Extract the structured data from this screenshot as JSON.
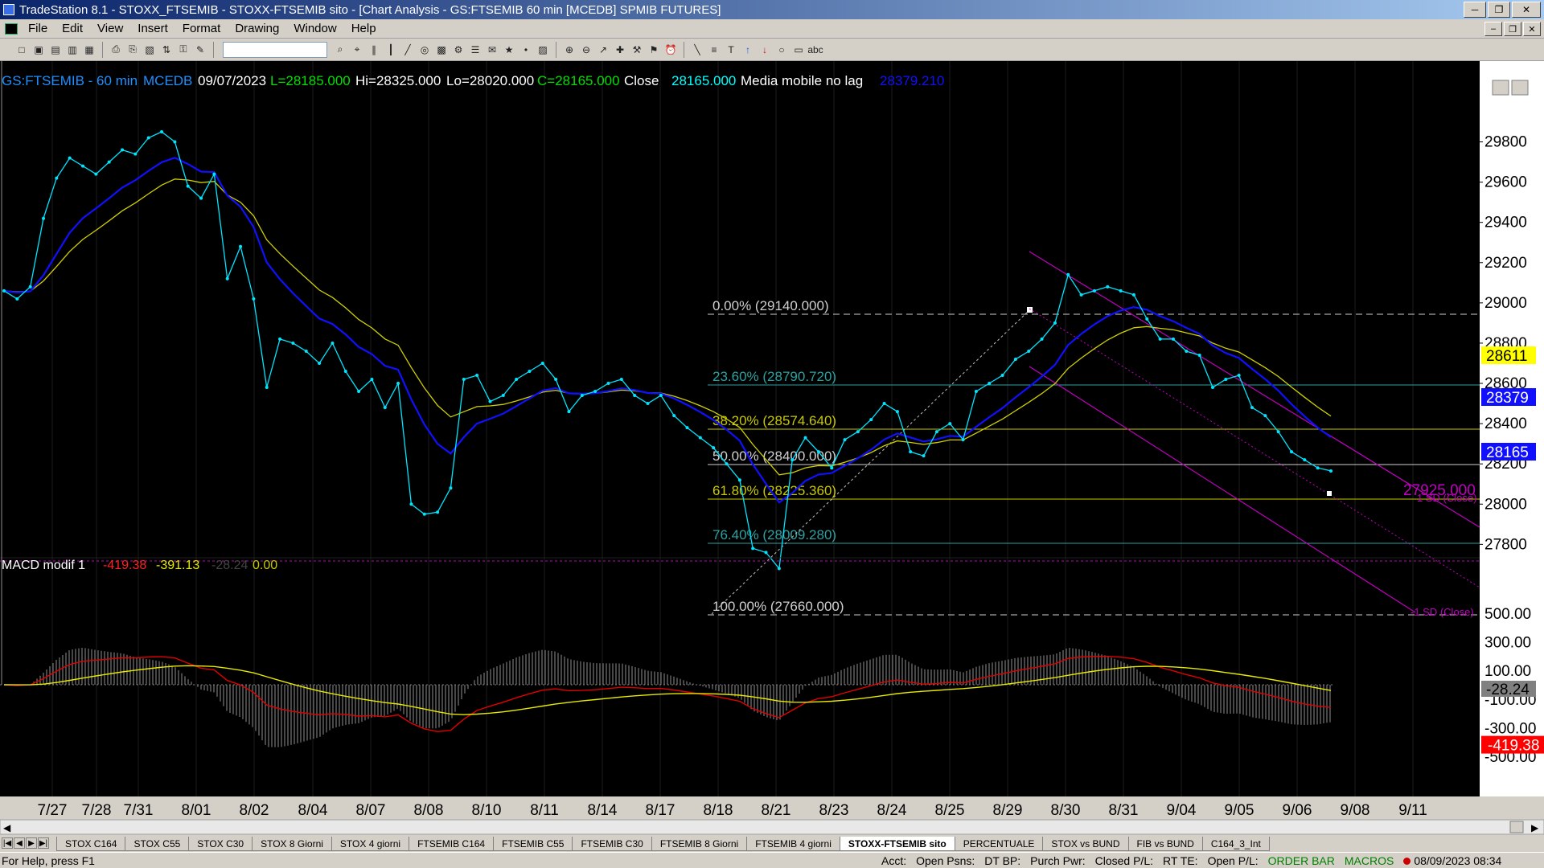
{
  "window": {
    "title": "TradeStation 8.1 - STOXX_FTSEMIB - STOXX-FTSEMIB sito - [Chart Analysis - GS:FTSEMIB  60 min  [MCEDB] SPMIB FUTURES]",
    "minimize": "─",
    "restore": "❐",
    "close": "✕"
  },
  "menu": [
    "File",
    "Edit",
    "View",
    "Insert",
    "Format",
    "Drawing",
    "Window",
    "Help"
  ],
  "toolbar": {
    "symbol_combo": "",
    "icons": [
      "new-icon",
      "open-icon",
      "open-workspace-icon",
      "template-icon",
      "folder-icon",
      "print-icon",
      "print-preview-icon",
      "chart-icon",
      "scroll-icon",
      "lock-icon",
      "format-icon",
      "find-icon",
      "zoom-icon",
      "bars-icon",
      "candles-icon",
      "line-icon",
      "radar-icon",
      "matrix-icon",
      "options-icon",
      "quotes-icon",
      "news-icon",
      "hotlist-icon",
      "tick-icon",
      "data-icon",
      "zoom-in-icon",
      "zoom-out-icon",
      "pointer-icon",
      "crosshair-icon",
      "tools-icon",
      "strategy-icon",
      "alert-icon",
      "trendline-icon",
      "fib-icon",
      "text-icon",
      "up-arrow-icon",
      "down-arrow-icon",
      "circle-icon",
      "rectangle-icon",
      "abc-icon"
    ]
  },
  "chart": {
    "header": {
      "symbol": "GS:FTSEMIB - 60 min",
      "code": "MCEDB",
      "date": "09/07/2023",
      "last": "L=28185.000",
      "high": "Hi=28325.000",
      "low": "Lo=28020.000",
      "close_eq": "C=28165.000",
      "close_label": "Close",
      "close_val": "28165.000",
      "ma_label": "Media mobile no lag",
      "ma_val": "28379.210"
    },
    "macd_header": {
      "name": "MACD modif 1",
      "v1": "-419.38",
      "v2": "-391.13",
      "v3": "-28.24",
      "v4": "0.00"
    },
    "price_axis": [
      "29800",
      "29600",
      "29400",
      "29200",
      "29000",
      "28800",
      "28600",
      "28400",
      "28200",
      "28000",
      "27800"
    ],
    "price_labels": {
      "ma1": "28611",
      "ma2": "28379",
      "close": "28165",
      "hline": "27925.000"
    },
    "macd_axis": [
      "500.00",
      "300.00",
      "100.00",
      "-100.00",
      "-300.00",
      "-500.00"
    ],
    "macd_labels": {
      "hist": "-28.24",
      "macd": "-419.38"
    },
    "date_axis": [
      "7/27",
      "7/28",
      "7/31",
      "8/01",
      "8/02",
      "8/04",
      "8/07",
      "8/08",
      "8/10",
      "8/11",
      "8/14",
      "8/17",
      "8/18",
      "8/21",
      "8/23",
      "8/24",
      "8/25",
      "8/29",
      "8/30",
      "8/31",
      "9/04",
      "9/05",
      "9/06",
      "9/08",
      "9/11"
    ],
    "fib_levels": [
      {
        "label": "0.00% (29140.000)",
        "color": "#d0d0d0"
      },
      {
        "label": "23.60% (28790.720)",
        "color": "#2fa0a0"
      },
      {
        "label": "38.20% (28574.640)",
        "color": "#c8c800"
      },
      {
        "label": "50.00% (28400.000)",
        "color": "#d0d0d0"
      },
      {
        "label": "61.80% (28225.360)",
        "color": "#c8c800"
      },
      {
        "label": "76.40% (28009.280)",
        "color": "#2fa0a0"
      },
      {
        "label": "100.00% (27660.000)",
        "color": "#d0d0d0"
      }
    ],
    "channel_labels": {
      "upper": "1 SD (Close)",
      "lower": "-1 SD (Close)"
    },
    "colors": {
      "background": "#000000",
      "price": "#00e5ff",
      "ma_fast": "#1010ff",
      "ma_slow": "#d0d000",
      "macd": "#e00000",
      "signal": "#e8e800",
      "channel": "#c000c0",
      "hist": "#909090"
    }
  },
  "tabs": [
    "STOX C164",
    "STOX C55",
    "STOX  C30",
    "STOX  8 Giorni",
    "STOX 4 giorni",
    "FTSEMIB C164",
    "FTSEMIB C55",
    "FTSEMIB C30",
    "FTSEMIB  8 Giorni",
    "FTSEMIB  4 giorni",
    "STOXX-FTSEMIB sito",
    "PERCENTUALE",
    "STOX vs BUND",
    "FIB vs BUND",
    "C164_3_Int"
  ],
  "active_tab": "STOXX-FTSEMIB sito",
  "status": {
    "help": "For Help, press F1",
    "acct": "Acct:",
    "open_psns": "Open Psns:",
    "dt_bp": "DT BP:",
    "purch_pwr": "Purch Pwr:",
    "closed_pl": "Closed P/L:",
    "rt_te": "RT TE:",
    "open_pl": "Open P/L:",
    "order_bar": "ORDER BAR",
    "macros": "MACROS",
    "datetime": "08/09/2023 08:34"
  }
}
